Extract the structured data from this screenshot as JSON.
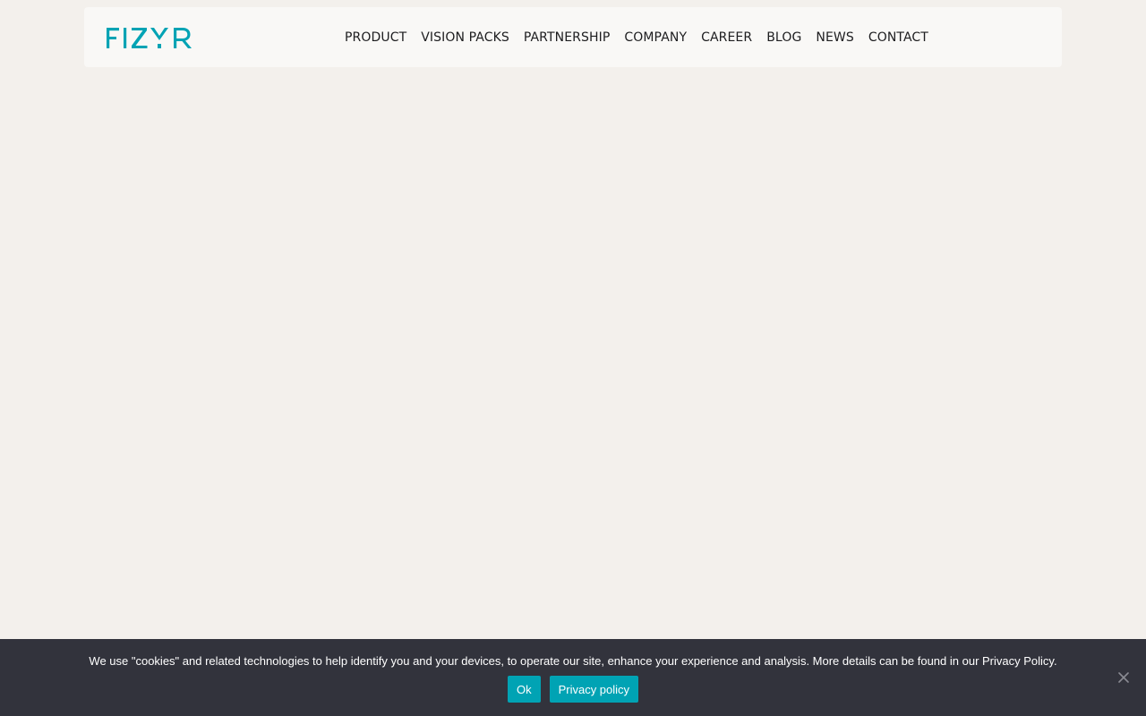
{
  "header": {
    "logo_text": "FIZYR",
    "brand_color": "#00a3b4",
    "nav": [
      {
        "label": "PRODUCT"
      },
      {
        "label": "VISION PACKS"
      },
      {
        "label": "PARTNERSHIP"
      },
      {
        "label": "COMPANY"
      },
      {
        "label": "CAREER"
      },
      {
        "label": "BLOG"
      },
      {
        "label": "NEWS"
      },
      {
        "label": "CONTACT"
      }
    ]
  },
  "cookie_notice": {
    "text": "We use \"cookies\" and related technologies to help identify you and your devices, to operate our site, enhance your experience and analysis. More details can be found in our Privacy Policy.",
    "ok_label": "Ok",
    "privacy_label": "Privacy policy",
    "close_icon": "close-icon"
  }
}
